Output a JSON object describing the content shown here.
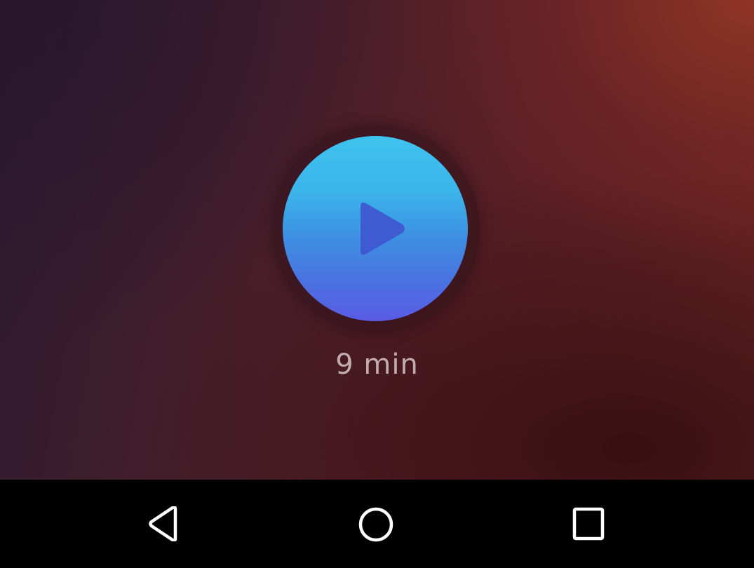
{
  "player": {
    "duration_label": "9 min",
    "play_button_color_top": "#3ec3ee",
    "play_button_color_bottom": "#5a5ce5",
    "play_icon_color": "#3f57cf",
    "play_icon": "play-icon"
  },
  "navbar": {
    "items": [
      {
        "icon": "back-icon"
      },
      {
        "icon": "home-icon"
      },
      {
        "icon": "recents-icon"
      }
    ]
  }
}
